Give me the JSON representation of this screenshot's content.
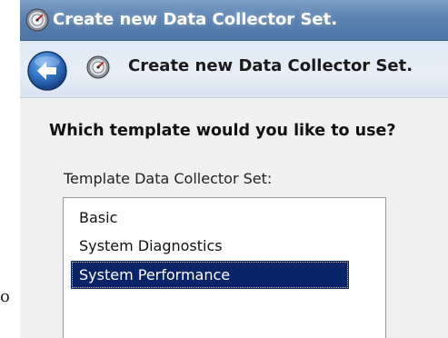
{
  "window": {
    "title": "Create new Data Collector Set.",
    "icon": "data-collector-set-icon"
  },
  "nav": {
    "back_icon": "back-arrow-icon",
    "page_icon": "data-collector-set-icon",
    "title": "Create new Data Collector Set."
  },
  "content": {
    "question": "Which template would you like to use?",
    "list_label": "Template Data Collector Set:",
    "templates": [
      {
        "label": "Basic",
        "selected": false
      },
      {
        "label": "System Diagnostics",
        "selected": false
      },
      {
        "label": "System Performance",
        "selected": true
      }
    ]
  },
  "background_fragment": "o",
  "colors": {
    "titlebar": "#5b82b1",
    "selection": "#0a246a",
    "back_button": "#2f6fc1"
  }
}
